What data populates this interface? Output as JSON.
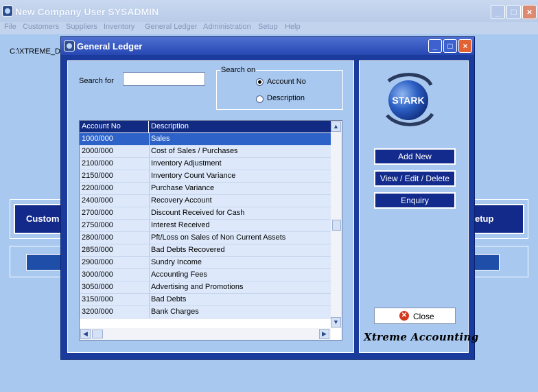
{
  "window": {
    "title": "New Company  User SYSADMIN",
    "minimize_symbol": "_",
    "maximize_symbol": "□",
    "close_symbol": "×"
  },
  "menu": [
    "File",
    "Customers",
    "Suppliers",
    "Inventory",
    "General Ledger",
    "Administration",
    "Setup",
    "Help"
  ],
  "background": {
    "path_label": "C:\\XTREME_D",
    "left_button": "Custom",
    "right_button": "etup"
  },
  "dialog": {
    "title": "General Ledger",
    "minimize_symbol": "_",
    "maximize_symbol": "□",
    "close_symbol": "×",
    "search_label": "Search for",
    "search_value": "",
    "search_on": {
      "legend": "Search on",
      "options": [
        {
          "label": "Account No",
          "selected": true
        },
        {
          "label": "Description",
          "selected": false
        }
      ]
    },
    "grid": {
      "columns": [
        "Account No",
        "Description"
      ],
      "rows": [
        {
          "account": "1000/000",
          "description": "Sales",
          "selected": true
        },
        {
          "account": "2000/000",
          "description": "Cost of Sales / Purchases"
        },
        {
          "account": "2100/000",
          "description": "Inventory Adjustment"
        },
        {
          "account": "2150/000",
          "description": "Inventory Count Variance"
        },
        {
          "account": "2200/000",
          "description": "Purchase Variance"
        },
        {
          "account": "2400/000",
          "description": "Recovery Account"
        },
        {
          "account": "2700/000",
          "description": "Discount Received for Cash"
        },
        {
          "account": "2750/000",
          "description": "Interest Received"
        },
        {
          "account": "2800/000",
          "description": "Pft/Loss on Sales of Non Current Assets"
        },
        {
          "account": "2850/000",
          "description": "Bad Debts Recovered"
        },
        {
          "account": "2900/000",
          "description": "Sundry Income"
        },
        {
          "account": "3000/000",
          "description": "Accounting Fees"
        },
        {
          "account": "3050/000",
          "description": "Advertising and Promotions"
        },
        {
          "account": "3150/000",
          "description": "Bad Debts"
        },
        {
          "account": "3200/000",
          "description": "Bank Charges"
        }
      ]
    },
    "buttons": {
      "add_new": "Add New",
      "view_edit_delete": "View / Edit / Delete",
      "enquiry": "Enquiry",
      "close": "Close"
    },
    "logo_text": "STARK",
    "brand": "Xtreme Accounting"
  },
  "colors": {
    "dialog_frame": "#1a3b9c",
    "panel_bg": "#a8c8f0",
    "selected_row": "#2d62c8",
    "header_bg": "#112a82"
  }
}
